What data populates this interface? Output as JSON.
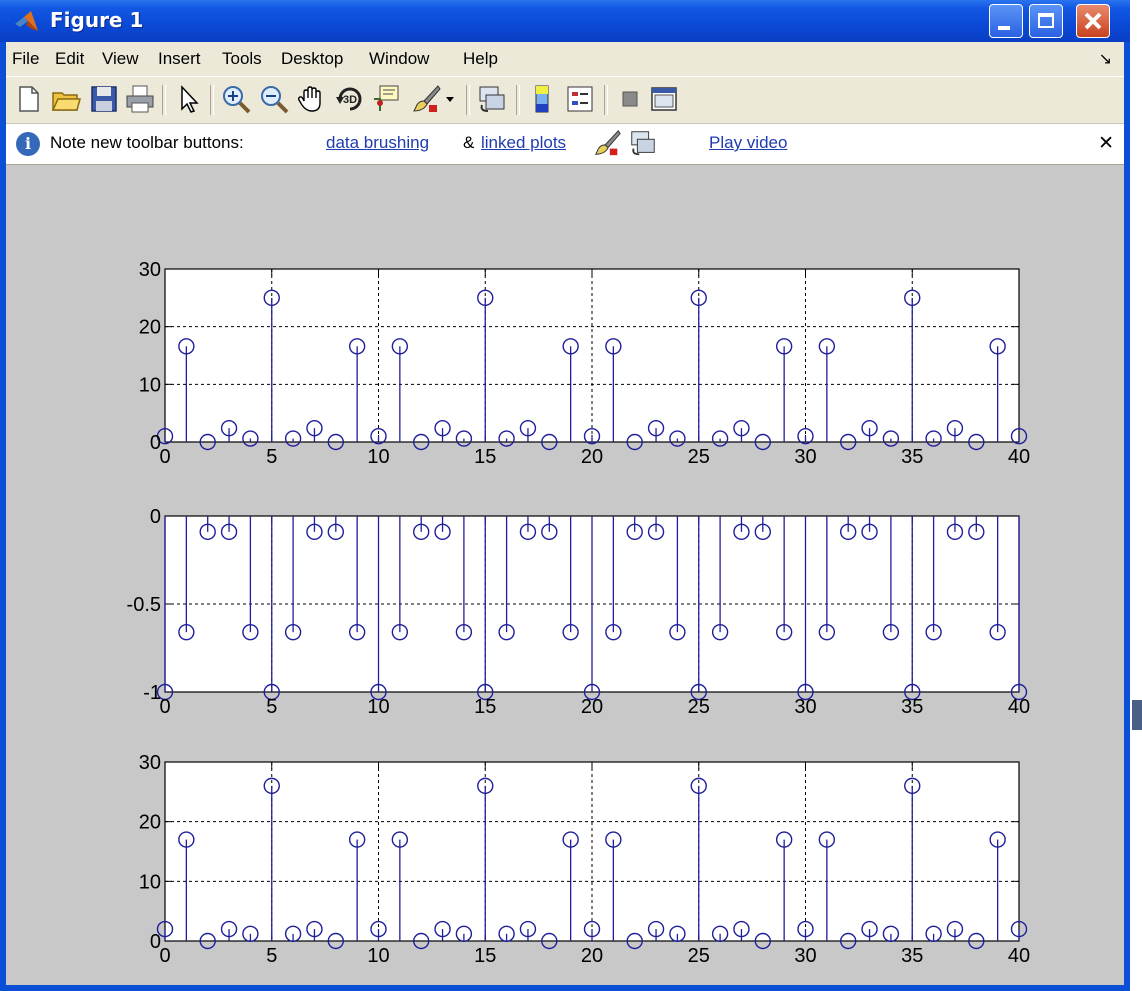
{
  "window": {
    "title": "Figure 1"
  },
  "menu": [
    "File",
    "Edit",
    "View",
    "Insert",
    "Tools",
    "Desktop",
    "Window",
    "Help"
  ],
  "toolbar_icons": [
    "new-file-icon",
    "open-folder-icon",
    "save-icon",
    "print-icon",
    "pointer-icon",
    "zoom-in-icon",
    "zoom-out-icon",
    "pan-hand-icon",
    "rotate-3d-icon",
    "data-cursor-icon",
    "data-brushing-icon",
    "dropdown-arrow-icon",
    "linked-plots-icon",
    "colorbar-icon",
    "legend-icon",
    "hide-plot-tools-icon",
    "show-plot-tools-icon"
  ],
  "info": {
    "prefix": "Note new toolbar buttons:",
    "link1": "data brushing",
    "amp": "&",
    "link2": "linked plots",
    "video": "Play video"
  },
  "colors": {
    "stem": "#1f1f9a",
    "axes_bg": "#ffffff",
    "figure_bg": "#c8c8c8"
  },
  "chart_data": [
    {
      "type": "stem",
      "title": "",
      "xlabel": "",
      "ylabel": "",
      "xlim": [
        0,
        40
      ],
      "ylim": [
        0,
        30
      ],
      "xticks": [
        0,
        5,
        10,
        15,
        20,
        25,
        30,
        35,
        40
      ],
      "yticks": [
        0,
        10,
        20,
        30
      ],
      "grid": true,
      "x": [
        0,
        1,
        2,
        3,
        4,
        5,
        6,
        7,
        8,
        9,
        10,
        11,
        12,
        13,
        14,
        15,
        16,
        17,
        18,
        19,
        20,
        21,
        22,
        23,
        24,
        25,
        26,
        27,
        28,
        29,
        30,
        31,
        32,
        33,
        34,
        35,
        36,
        37,
        38,
        39,
        40
      ],
      "values": [
        1,
        16.6,
        0,
        2.4,
        0.6,
        25,
        0.6,
        2.4,
        0,
        16.6,
        1,
        16.6,
        0,
        2.4,
        0.6,
        25,
        0.6,
        2.4,
        0,
        16.6,
        1,
        16.6,
        0,
        2.4,
        0.6,
        25,
        0.6,
        2.4,
        0,
        16.6,
        1,
        16.6,
        0,
        2.4,
        0.6,
        25,
        0.6,
        2.4,
        0,
        16.6,
        1
      ]
    },
    {
      "type": "stem",
      "title": "",
      "xlabel": "",
      "ylabel": "",
      "xlim": [
        0,
        40
      ],
      "ylim": [
        -1,
        0
      ],
      "xticks": [
        0,
        5,
        10,
        15,
        20,
        25,
        30,
        35,
        40
      ],
      "yticks": [
        -1,
        -0.5,
        0
      ],
      "ytick_labels": [
        "-1",
        "-0.5",
        "0"
      ],
      "grid": true,
      "x": [
        0,
        1,
        2,
        3,
        4,
        5,
        6,
        7,
        8,
        9,
        10,
        11,
        12,
        13,
        14,
        15,
        16,
        17,
        18,
        19,
        20,
        21,
        22,
        23,
        24,
        25,
        26,
        27,
        28,
        29,
        30,
        31,
        32,
        33,
        34,
        35,
        36,
        37,
        38,
        39,
        40
      ],
      "values": [
        -1,
        -0.66,
        -0.09,
        -0.09,
        -0.66,
        -1,
        -0.66,
        -0.09,
        -0.09,
        -0.66,
        -1,
        -0.66,
        -0.09,
        -0.09,
        -0.66,
        -1,
        -0.66,
        -0.09,
        -0.09,
        -0.66,
        -1,
        -0.66,
        -0.09,
        -0.09,
        -0.66,
        -1,
        -0.66,
        -0.09,
        -0.09,
        -0.66,
        -1,
        -0.66,
        -0.09,
        -0.09,
        -0.66,
        -1,
        -0.66,
        -0.09,
        -0.09,
        -0.66,
        -1
      ]
    },
    {
      "type": "stem",
      "title": "",
      "xlabel": "",
      "ylabel": "",
      "xlim": [
        0,
        40
      ],
      "ylim": [
        0,
        30
      ],
      "xticks": [
        0,
        5,
        10,
        15,
        20,
        25,
        30,
        35,
        40
      ],
      "yticks": [
        0,
        10,
        20,
        30
      ],
      "grid": true,
      "x": [
        0,
        1,
        2,
        3,
        4,
        5,
        6,
        7,
        8,
        9,
        10,
        11,
        12,
        13,
        14,
        15,
        16,
        17,
        18,
        19,
        20,
        21,
        22,
        23,
        24,
        25,
        26,
        27,
        28,
        29,
        30,
        31,
        32,
        33,
        34,
        35,
        36,
        37,
        38,
        39,
        40
      ],
      "values": [
        2,
        17,
        0,
        2,
        1.2,
        26,
        1.2,
        2,
        0,
        17,
        2,
        17,
        0,
        2,
        1.2,
        26,
        1.2,
        2,
        0,
        17,
        2,
        17,
        0,
        2,
        1.2,
        26,
        1.2,
        2,
        0,
        17,
        2,
        17,
        0,
        2,
        1.2,
        26,
        1.2,
        2,
        0,
        17,
        2
      ]
    }
  ]
}
